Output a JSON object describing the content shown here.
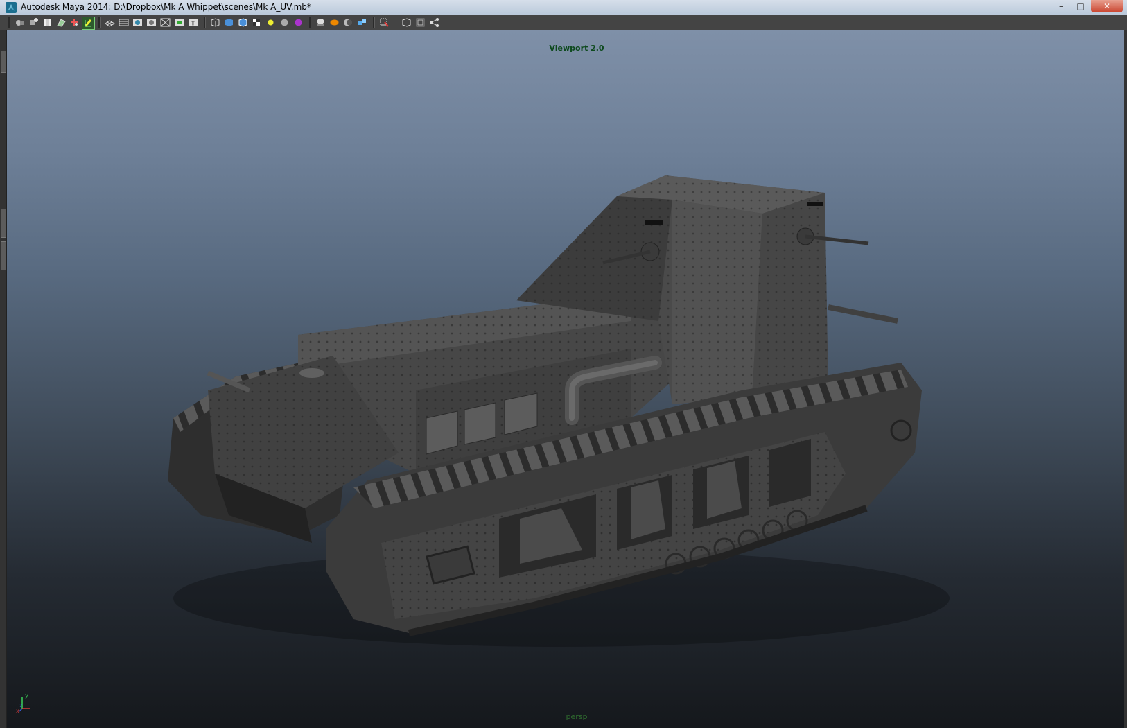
{
  "window": {
    "title": "Autodesk Maya 2014: D:\\Dropbox\\Mk A Whippet\\scenes\\Mk A_UV.mb*",
    "controls": {
      "minimize": "–",
      "maximize": "□",
      "close": "✕"
    }
  },
  "toolbar": {
    "buttons": [
      {
        "name": "select-camera-icon"
      },
      {
        "name": "camera-attributes-icon"
      },
      {
        "name": "bookmarks-icon"
      },
      {
        "name": "image-plane-icon"
      },
      {
        "name": "two-d-pan-zoom-icon"
      },
      {
        "name": "grease-pencil-icon"
      },
      {
        "name": "grid-icon"
      },
      {
        "name": "film-gate-icon"
      },
      {
        "name": "resolution-gate-icon"
      },
      {
        "name": "gate-mask-icon"
      },
      {
        "name": "field-chart-icon"
      },
      {
        "name": "safe-action-icon"
      },
      {
        "name": "safe-title-icon"
      },
      {
        "name": "wireframe-icon"
      },
      {
        "name": "smooth-shade-icon"
      },
      {
        "name": "wireframe-on-shaded-icon"
      },
      {
        "name": "textured-icon"
      },
      {
        "name": "use-all-lights-icon"
      },
      {
        "name": "shadows-icon"
      },
      {
        "name": "screen-space-ao-icon"
      },
      {
        "name": "motion-blur-icon"
      },
      {
        "name": "multisample-aa-icon"
      },
      {
        "name": "depth-of-field-icon"
      },
      {
        "name": "isolate-select-icon"
      },
      {
        "name": "xray-icon"
      },
      {
        "name": "xray-joints-icon"
      },
      {
        "name": "xray-components-icon"
      }
    ]
  },
  "viewport": {
    "renderer_label": "Viewport 2.0",
    "camera_label": "persp",
    "axis": {
      "x": "x",
      "y": "y",
      "z": "z"
    },
    "colors": {
      "renderer_label": "#0e4a1e",
      "camera_label": "#2f6c2f",
      "axis_x": "#d33a3a",
      "axis_y": "#3ad35a",
      "axis_z": "#3a5ad3"
    }
  }
}
